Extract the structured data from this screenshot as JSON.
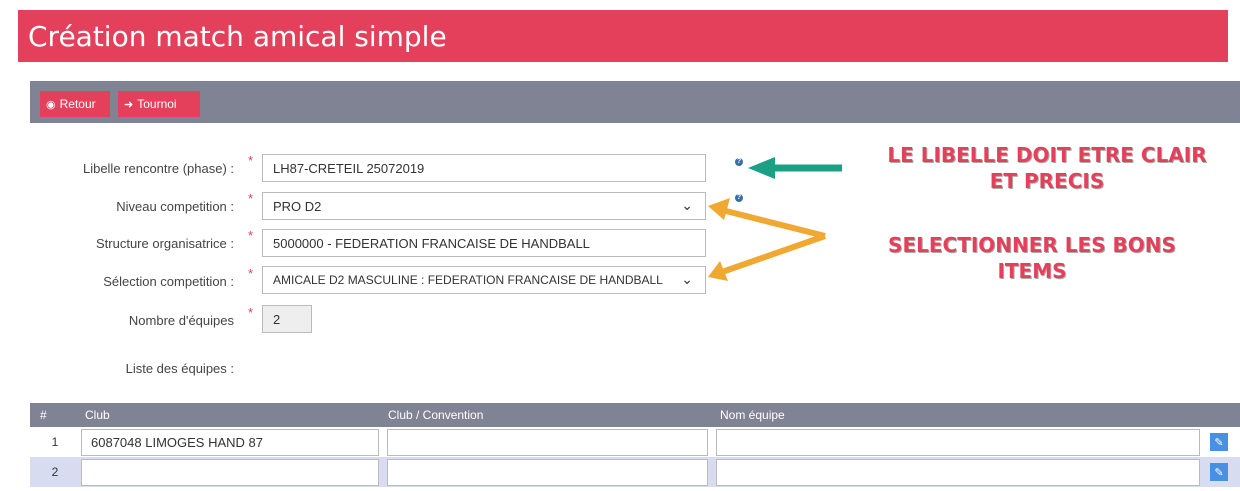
{
  "page": {
    "title": "Création match amical simple"
  },
  "toolbar": {
    "back_label": "Retour",
    "tournoi_label": "Tournoi"
  },
  "form": {
    "libelle": {
      "label": "Libelle rencontre (phase) :",
      "value": "LH87-CRETEIL 25072019"
    },
    "niveau": {
      "label": "Niveau competition :",
      "value": "PRO D2"
    },
    "structure": {
      "label": "Structure organisatrice :",
      "value": "5000000 - FEDERATION FRANCAISE DE HANDBALL"
    },
    "selection": {
      "label": "Sélection competition :",
      "value": "AMICALE D2 MASCULINE : FEDERATION FRANCAISE DE HANDBALL"
    },
    "nombre": {
      "label": "Nombre d'équipes",
      "value": "2"
    },
    "liste_label": "Liste des équipes :",
    "required_mark": "*",
    "help_mark": "?"
  },
  "annotations": {
    "libelle_note_line1": "LE LIBELLE DOIT ETRE CLAIR",
    "libelle_note_line2": "ET PRECIS",
    "select_note_line1": "SELECTIONNER LES BONS",
    "select_note_line2": "ITEMS"
  },
  "table": {
    "headers": [
      "#",
      "Club",
      "Club / Convention",
      "Nom équipe"
    ],
    "rows": [
      {
        "num": "1",
        "club": "6087048 LIMOGES HAND 87",
        "convention": "",
        "nom": ""
      },
      {
        "num": "2",
        "club": "",
        "convention": "",
        "nom": ""
      }
    ]
  },
  "colors": {
    "accent": "#e5405b",
    "toolbar": "#808394",
    "arrow_teal": "#1aa085",
    "arrow_orange": "#f0a830",
    "edit_blue": "#4a90e2"
  },
  "icons": {
    "back": "arrow-left-circle-icon",
    "tournoi": "sign-in-icon",
    "help": "question-circle-icon",
    "chevron": "chevron-down-icon",
    "edit": "edit-icon"
  }
}
